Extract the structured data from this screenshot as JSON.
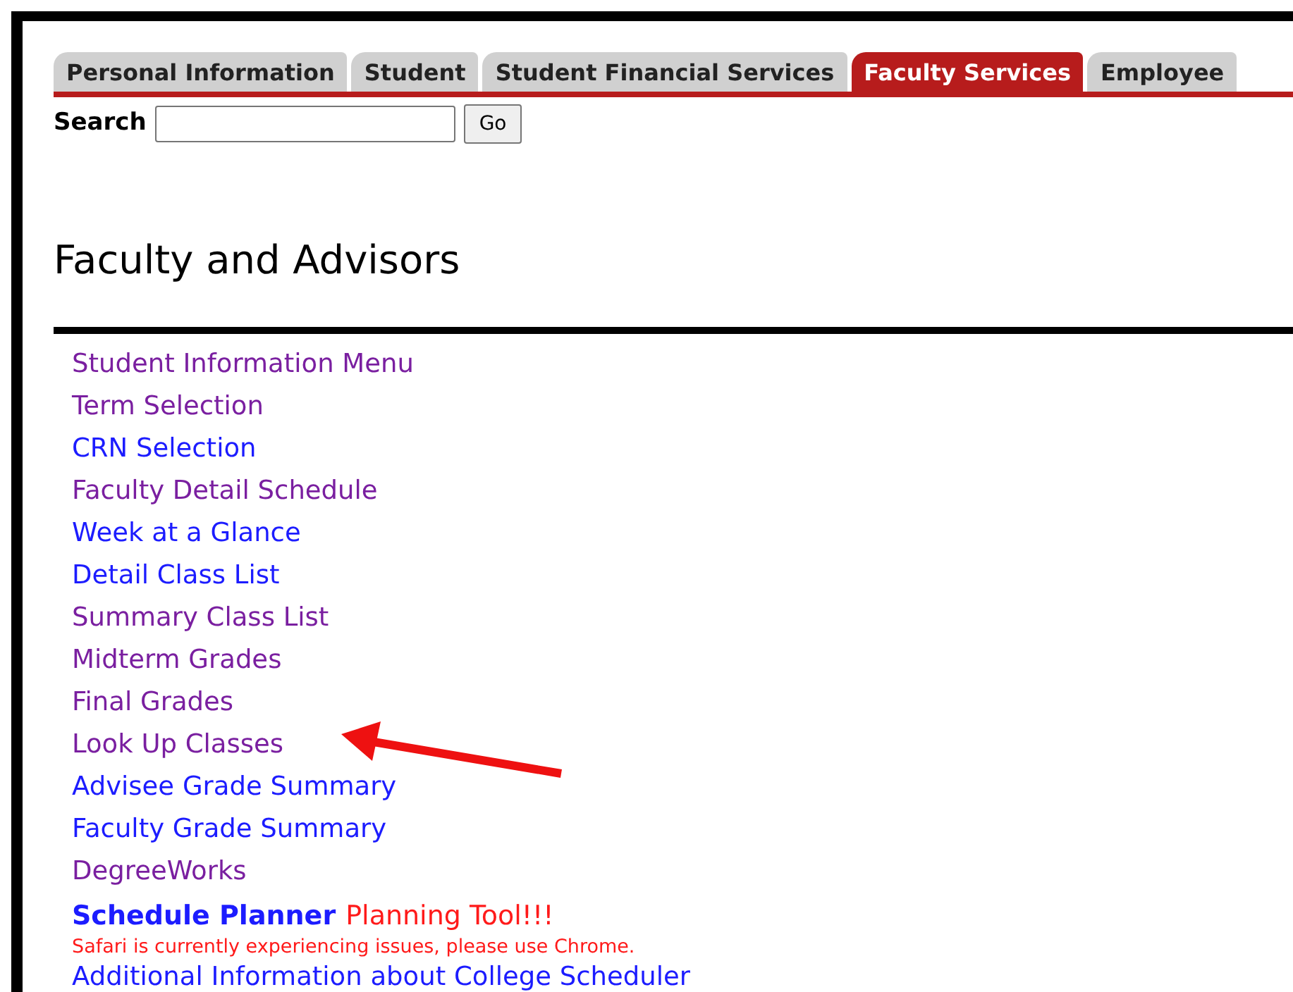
{
  "tabs": [
    {
      "label": "Personal Information",
      "selected": false
    },
    {
      "label": "Student",
      "selected": false
    },
    {
      "label": "Student Financial Services",
      "selected": false
    },
    {
      "label": "Faculty Services",
      "selected": true
    },
    {
      "label": "Employee",
      "selected": false
    }
  ],
  "search": {
    "label": "Search",
    "button": "Go"
  },
  "heading": "Faculty and Advisors",
  "links": [
    {
      "label": "Student Information Menu",
      "visited": true
    },
    {
      "label": "Term Selection",
      "visited": true
    },
    {
      "label": "CRN Selection",
      "visited": false
    },
    {
      "label": "Faculty Detail Schedule",
      "visited": true
    },
    {
      "label": "Week at a Glance",
      "visited": false
    },
    {
      "label": "Detail Class List",
      "visited": false
    },
    {
      "label": "Summary Class List",
      "visited": true
    },
    {
      "label": "Midterm Grades",
      "visited": true
    },
    {
      "label": "Final Grades",
      "visited": true
    },
    {
      "label": "Look Up Classes",
      "visited": true
    },
    {
      "label": "Advisee Grade Summary",
      "visited": false
    },
    {
      "label": "Faculty Grade Summary",
      "visited": false
    },
    {
      "label": "DegreeWorks",
      "visited": true
    }
  ],
  "planner": {
    "link": "Schedule Planner",
    "tagline": "Planning Tool!!!",
    "notice": "Safari is currently experiencing issues, please use Chrome."
  },
  "last_link": {
    "label": "Additional Information about College Scheduler",
    "visited": false
  }
}
